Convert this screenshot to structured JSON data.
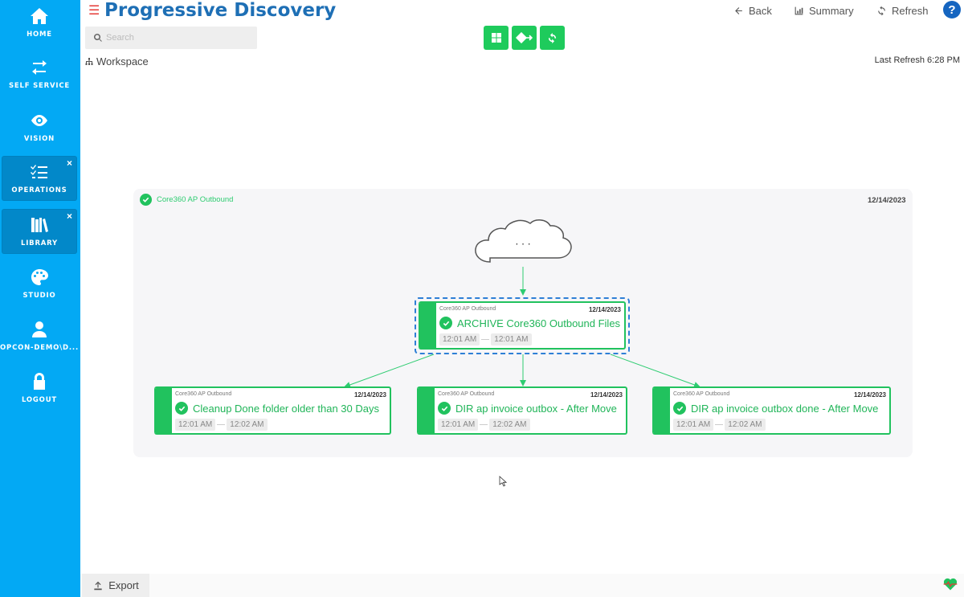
{
  "app": {
    "title": "Progressive Discovery"
  },
  "sidebar": {
    "items": [
      {
        "label": "HOME",
        "icon": "home-icon"
      },
      {
        "label": "SELF SERVICE",
        "icon": "swap-arrows-icon"
      },
      {
        "label": "VISION",
        "icon": "eye-icon"
      },
      {
        "label": "OPERATIONS",
        "icon": "checklist-icon",
        "closable": "×"
      },
      {
        "label": "LIBRARY",
        "icon": "books-icon",
        "closable": "×"
      },
      {
        "label": "STUDIO",
        "icon": "palette-icon"
      },
      {
        "label": "OPCON-DEMO\\D...",
        "icon": "user-icon"
      },
      {
        "label": "LOGOUT",
        "icon": "lock-icon"
      }
    ]
  },
  "search": {
    "placeholder": "Search"
  },
  "header": {
    "back_label": "Back",
    "summary_label": "Summary",
    "refresh_label": "Refresh",
    "help_label": "?"
  },
  "breadcrumb": {
    "label": "Workspace"
  },
  "last_refresh": "Last Refresh 6:28 PM",
  "diagram": {
    "group": {
      "name": "Core360 AP Outbound",
      "date": "12/14/2023"
    },
    "cloud_label": "· · ·",
    "jobs": [
      {
        "schedule": "Core360 AP Outbound",
        "date": "12/14/2023",
        "name": "ARCHIVE Core360 Outbound Files",
        "start": "12:01 AM",
        "end": "12:01 AM",
        "status": "success"
      },
      {
        "schedule": "Core360 AP Outbound",
        "date": "12/14/2023",
        "name": "Cleanup Done folder older than 30 Days",
        "start": "12:01 AM",
        "end": "12:02 AM",
        "status": "success"
      },
      {
        "schedule": "Core360 AP Outbound",
        "date": "12/14/2023",
        "name": "DIR ap invoice outbox - After Move",
        "start": "12:01 AM",
        "end": "12:02 AM",
        "status": "success"
      },
      {
        "schedule": "Core360 AP Outbound",
        "date": "12/14/2023",
        "name": "DIR ap invoice outbox done - After Move",
        "start": "12:01 AM",
        "end": "12:02 AM",
        "status": "success"
      }
    ]
  },
  "footer": {
    "export_label": "Export"
  },
  "colors": {
    "sidebar": "#03a9f4",
    "accent_green": "#21c25e",
    "title_blue": "#1e6fb5",
    "selection": "#2e7fd6"
  }
}
